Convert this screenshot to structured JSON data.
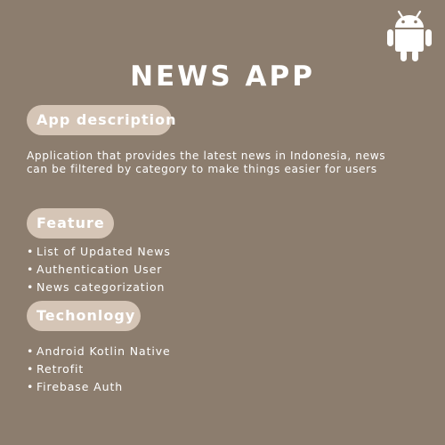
{
  "title": "NEWS APP",
  "logo_icon": "android-icon",
  "colors": {
    "background": "#8c7d6e",
    "pill": "#d5c5b6",
    "text": "#ffffff"
  },
  "sections": {
    "description": {
      "heading": "App description",
      "lines": [
        "Application that provides the latest news in Indonesia, news",
        "can be filtered by category to make things easier for users"
      ]
    },
    "feature": {
      "heading": "Feature",
      "items": [
        "List of Updated News",
        "Authentication User",
        "News categorization"
      ]
    },
    "technology": {
      "heading": "Techonlogy",
      "items": [
        "Android Kotlin Native",
        "Retrofit",
        "Firebase Auth"
      ]
    }
  }
}
